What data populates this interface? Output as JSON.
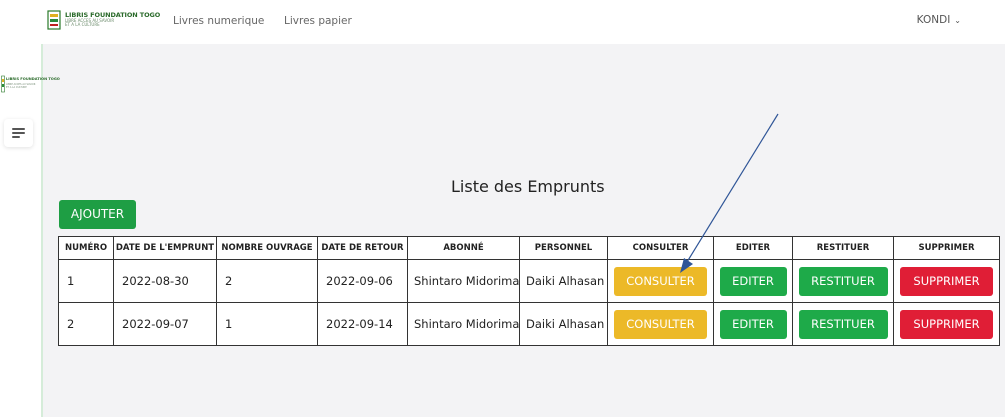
{
  "brand": {
    "name": "LIBRIS FOUNDATION TOGO",
    "tagline_1": "LIBRE ACCES AU SAVOIR",
    "tagline_2": "ET A LA CULTURE"
  },
  "nav": {
    "links": [
      "Livres numerique",
      "Livres papier"
    ],
    "user": "KONDI"
  },
  "page": {
    "title": "Liste des Emprunts",
    "add_button": "AJOUTER"
  },
  "table": {
    "headers": [
      "NUMÉRO",
      "DATE DE L'EMPRUNT",
      "NOMBRE OUVRAGE",
      "DATE DE RETOUR",
      "ABONNÉ",
      "PERSONNEL",
      "CONSULTER",
      "EDITER",
      "RESTITUER",
      "SUPPRIMER"
    ],
    "rows": [
      {
        "numero": "1",
        "date_emprunt": "2022-08-30",
        "nombre": "2",
        "date_retour": "2022-09-06",
        "abonne": "Shintaro Midorima",
        "personnel": "Daiki Alhasan"
      },
      {
        "numero": "2",
        "date_emprunt": "2022-09-07",
        "nombre": "1",
        "date_retour": "2022-09-14",
        "abonne": "Shintaro Midorima",
        "personnel": "Daiki Alhasan"
      }
    ],
    "actions": {
      "consulter": "CONSULTER",
      "editer": "EDITER",
      "restituer": "RESTITUER",
      "supprimer": "SUPPRIMER"
    }
  },
  "colors": {
    "add": "#1e9e44",
    "consulter": "#ecb928",
    "editer": "#1eaa49",
    "restituer": "#1eaa49",
    "supprimer": "#e01e36",
    "annotation_arrow": "#2f5597"
  },
  "icons": {
    "menu": "hamburger-menu-icon",
    "user_dropdown": "chevron-down-icon",
    "annotation": "arrow-annotation"
  }
}
